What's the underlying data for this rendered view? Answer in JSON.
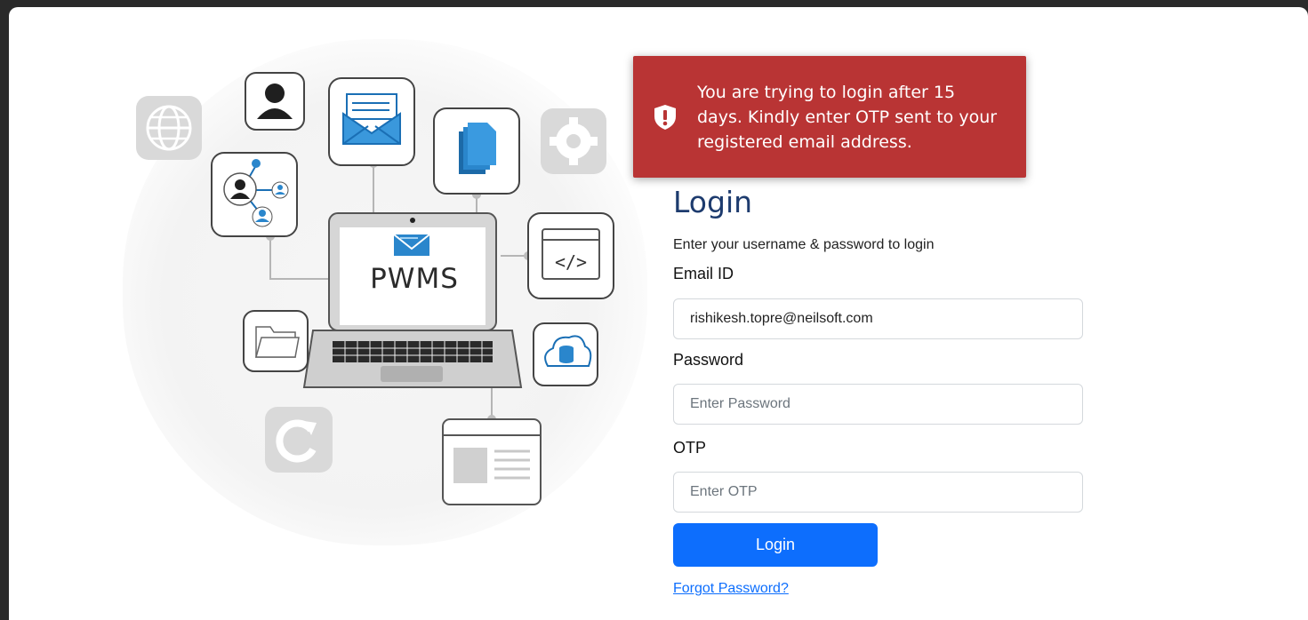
{
  "toast": {
    "message": "You are trying to login after 15 days. Kindly enter OTP sent to your registered email address.",
    "icon": "shield-alert-icon",
    "color": "#b93434"
  },
  "illustration": {
    "logo_text": "PWMS"
  },
  "login": {
    "title": "Login",
    "subtitle": "Enter your username & password to login",
    "email_label": "Email ID",
    "email_value": "rishikesh.topre@neilsoft.com",
    "password_label": "Password",
    "password_placeholder": "Enter Password",
    "otp_label": "OTP",
    "otp_placeholder": "Enter OTP",
    "button_label": "Login",
    "forgot_label": "Forgot Password?",
    "accent_color": "#0d6efd"
  }
}
